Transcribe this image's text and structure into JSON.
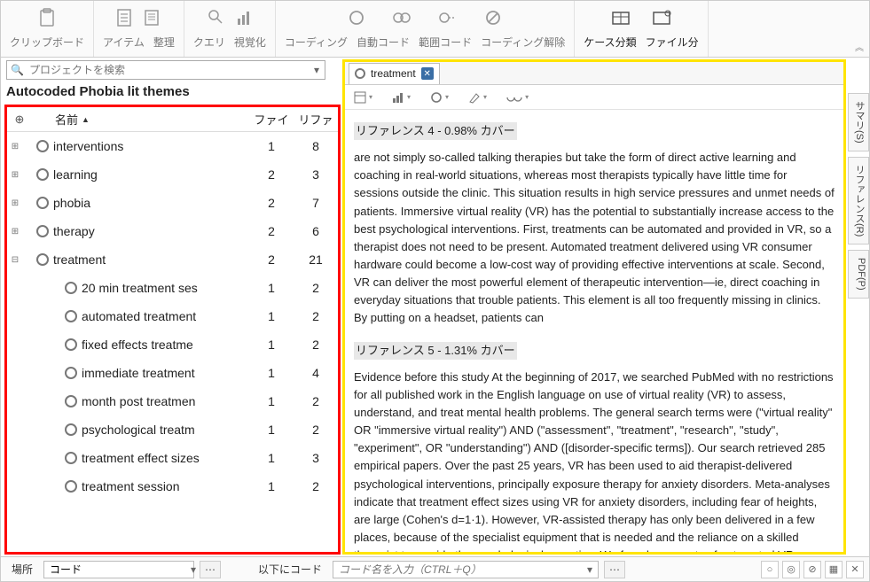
{
  "ribbon": [
    {
      "labels": [
        "クリップボード"
      ],
      "icons": [
        "clipboard"
      ]
    },
    {
      "labels": [
        "アイテム",
        "整理"
      ],
      "icons": [
        "item",
        "organize"
      ]
    },
    {
      "labels": [
        "クエリ",
        "視覚化"
      ],
      "icons": [
        "query",
        "visualize"
      ]
    },
    {
      "labels": [
        "コーディング",
        "自動コード",
        "範囲コード",
        "コーディング解除"
      ],
      "icons": [
        "code",
        "autocode",
        "range",
        "uncode"
      ]
    },
    {
      "labels": [
        "ケース分類",
        "ファイル分"
      ],
      "icons": [
        "case",
        "file"
      ],
      "active": true
    }
  ],
  "search": {
    "placeholder": "プロジェクトを検索"
  },
  "list_title": "Autocoded Phobia lit themes",
  "tree_header": {
    "name": "名前",
    "col1": "ファイ",
    "col2": "リファ"
  },
  "tree": [
    {
      "expand": "+",
      "name": "interventions",
      "c1": "1",
      "c2": "8"
    },
    {
      "expand": "+",
      "name": "learning",
      "c1": "2",
      "c2": "3"
    },
    {
      "expand": "+",
      "name": "phobia",
      "c1": "2",
      "c2": "7"
    },
    {
      "expand": "+",
      "name": "therapy",
      "c1": "2",
      "c2": "6"
    },
    {
      "expand": "−",
      "name": "treatment",
      "c1": "2",
      "c2": "21",
      "children": [
        {
          "name": "20 min treatment ses",
          "c1": "1",
          "c2": "2"
        },
        {
          "name": "automated treatment",
          "c1": "1",
          "c2": "2"
        },
        {
          "name": "fixed effects treatme",
          "c1": "1",
          "c2": "2"
        },
        {
          "name": "immediate treatment",
          "c1": "1",
          "c2": "4"
        },
        {
          "name": "month post treatmen",
          "c1": "1",
          "c2": "2"
        },
        {
          "name": "psychological treatm",
          "c1": "1",
          "c2": "2"
        },
        {
          "name": "treatment effect sizes",
          "c1": "1",
          "c2": "3"
        },
        {
          "name": "treatment session",
          "c1": "1",
          "c2": "2"
        }
      ]
    }
  ],
  "doc": {
    "tab_label": "treatment",
    "ref4_head": "リファレンス 4 - 0.98% カバー",
    "ref4_body": "are not simply so-called talking therapies but take the form of direct active learning and coaching in real-world situations, whereas most therapists typically have little time for sessions outside the clinic. This situation results in high service pressures and unmet needs of patients. Immersive virtual reality (VR) has the potential to substantially increase access to the best psychological interventions. First, treatments can be automated and provided in VR, so a therapist does not need to be present. Automated treatment delivered using VR consumer hardware could become a low-cost way of providing effective interventions at scale. Second, VR can deliver the most powerful element of therapeutic intervention—ie, direct coaching in everyday situations that trouble patients. This element is all too frequently missing in clinics. By putting on a headset, patients can",
    "ref5_head": "リファレンス 5 - 1.31% カバー",
    "ref5_body": "Evidence before this study At the beginning of 2017, we searched PubMed with no restrictions for all published work in the English language on use of virtual reality (VR) to assess, understand, and treat mental health problems. The general search terms were (\"virtual reality\" OR \"immersive virtual reality\") AND (\"assessment\", \"treatment\", \"research\", \"study\", \"experiment\", OR \"understanding\") AND ([disorder-specific terms]). Our search retrieved 285 empirical papers. Over the past 25 years, VR has been used to aid therapist-delivered psychological interventions, principally exposure therapy for anxiety disorders. Meta-analyses indicate that treatment effect sizes using VR for anxiety disorders, including fear of heights, are large (Cohen's d=1·1). However, VR-assisted therapy has only been delivered in a few places, because of the specialist equipment that is needed and the reliance on a skilled therapist to provide the psychological expertise. We found no reports of automated VR"
  },
  "side_tabs": [
    "サマリ(S)",
    "リファレンス(R)",
    "PDF(P)"
  ],
  "bottom": {
    "label1": "場所",
    "combo1": "コード",
    "label2": "以下にコード",
    "combo2_placeholder": "コード名を入力（CTRL＋Q）"
  }
}
